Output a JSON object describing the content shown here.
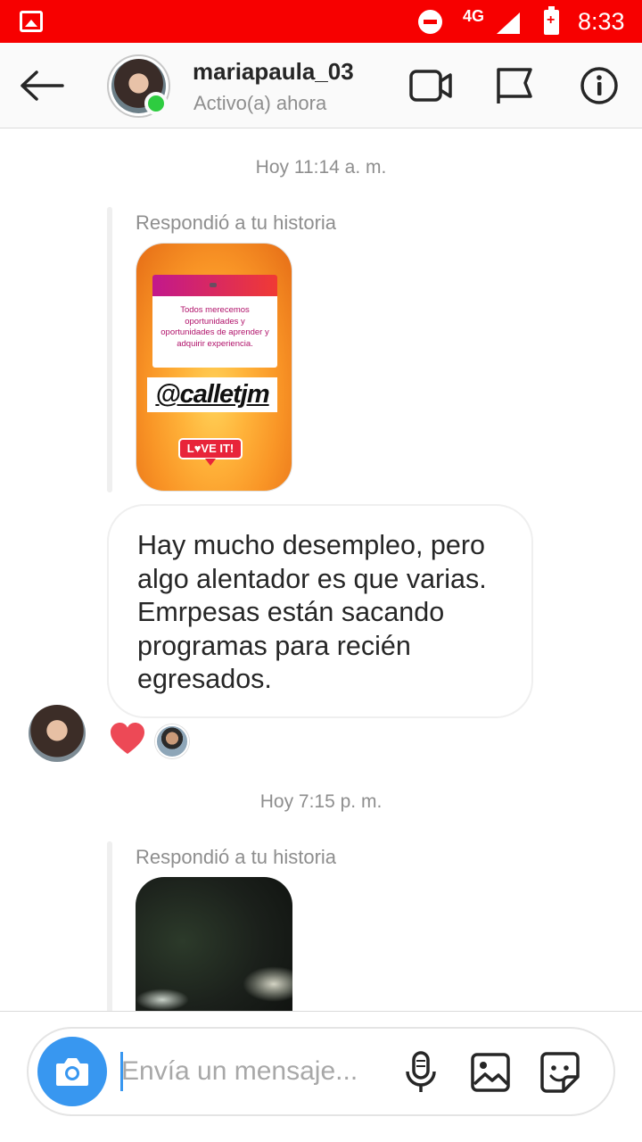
{
  "status_bar": {
    "network": "4G",
    "time": "8:33",
    "icons": [
      "gallery-notification-icon",
      "do-not-disturb-icon",
      "signal-icon",
      "battery-low-icon"
    ],
    "background_color": "#f70000"
  },
  "header": {
    "username": "mariapaula_03",
    "presence": "Activo(a) ahora",
    "icons": [
      "back-arrow-icon",
      "video-call-icon",
      "report-flag-icon",
      "info-icon"
    ],
    "online_color": "#2ecc40"
  },
  "conversation": {
    "timestamp_1": "Hoy 11:14 a. m.",
    "reply_label_1": "Respondió a tu historia",
    "story_1": {
      "card_text": "Todos merecemos oportunidades y oportunidades de aprender y adquirir experiencia.",
      "mention": "@calletjm",
      "sticker": "L♥VE IT!"
    },
    "message": "Hay mucho desempleo, pero algo alentador es que varias. Emrpesas están sacando programas para recién egresados.",
    "reaction": "heart",
    "timestamp_2": "Hoy 7:15 p. m.",
    "reply_label_2": "Respondió a tu historia"
  },
  "composer": {
    "placeholder": "Envía un mensaje...",
    "value": "",
    "icons": [
      "camera-icon",
      "microphone-icon",
      "gallery-icon",
      "sticker-icon"
    ],
    "accent_color": "#3897f0"
  }
}
